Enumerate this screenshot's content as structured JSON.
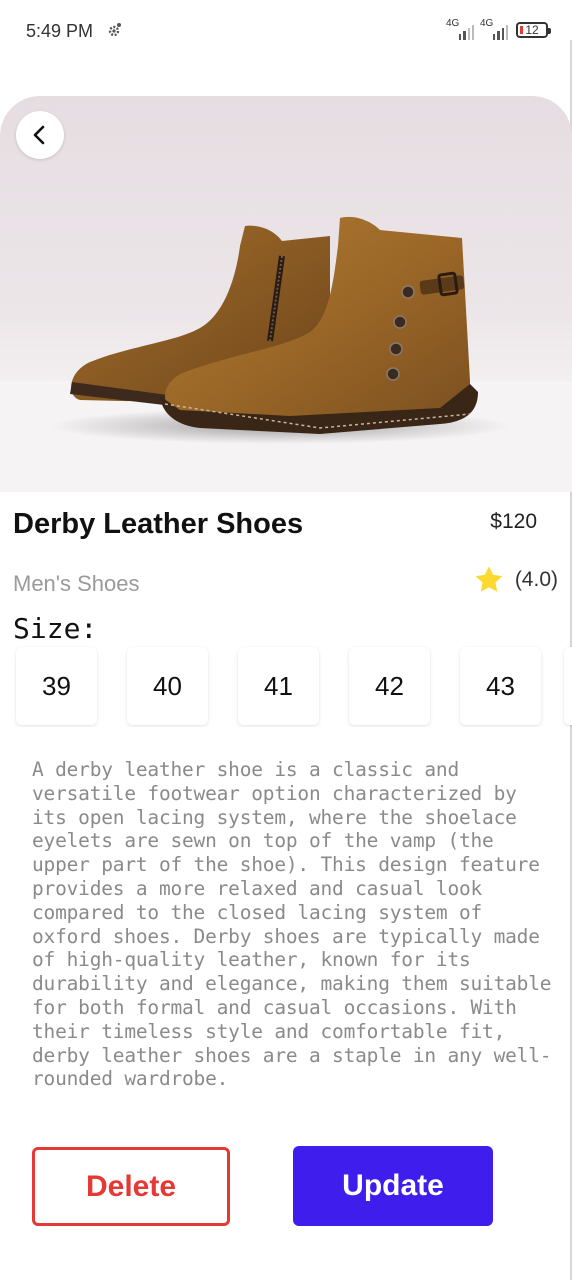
{
  "status_bar": {
    "time": "5:49 PM",
    "network_1": "4G",
    "network_2": "4G",
    "battery": "12"
  },
  "product": {
    "title": "Derby Leather Shoes",
    "price": "$120",
    "category": "Men's Shoes",
    "rating": "(4.0)",
    "size_label": "Size:",
    "sizes": [
      "39",
      "40",
      "41",
      "42",
      "43"
    ],
    "description": "A derby leather shoe is a classic and versatile footwear option characterized by its open lacing system, where the shoelace eyelets are sewn on top of the vamp (the upper part of the shoe). This design feature provides a more relaxed and casual look compared to the closed lacing system of oxford shoes. Derby shoes are typically made of high-quality leather, known for its durability and elegance, making them suitable for both formal and casual occasions. With their timeless style and comfortable fit, derby leather shoes are a staple in any well-rounded wardrobe."
  },
  "actions": {
    "delete_label": "Delete",
    "update_label": "Update"
  },
  "colors": {
    "accent": "#3f1ded",
    "danger": "#e53935",
    "star": "#fbd92e"
  },
  "icons": {
    "back": "chevron-left-icon",
    "rating": "star-icon",
    "status": "gear-icon"
  }
}
